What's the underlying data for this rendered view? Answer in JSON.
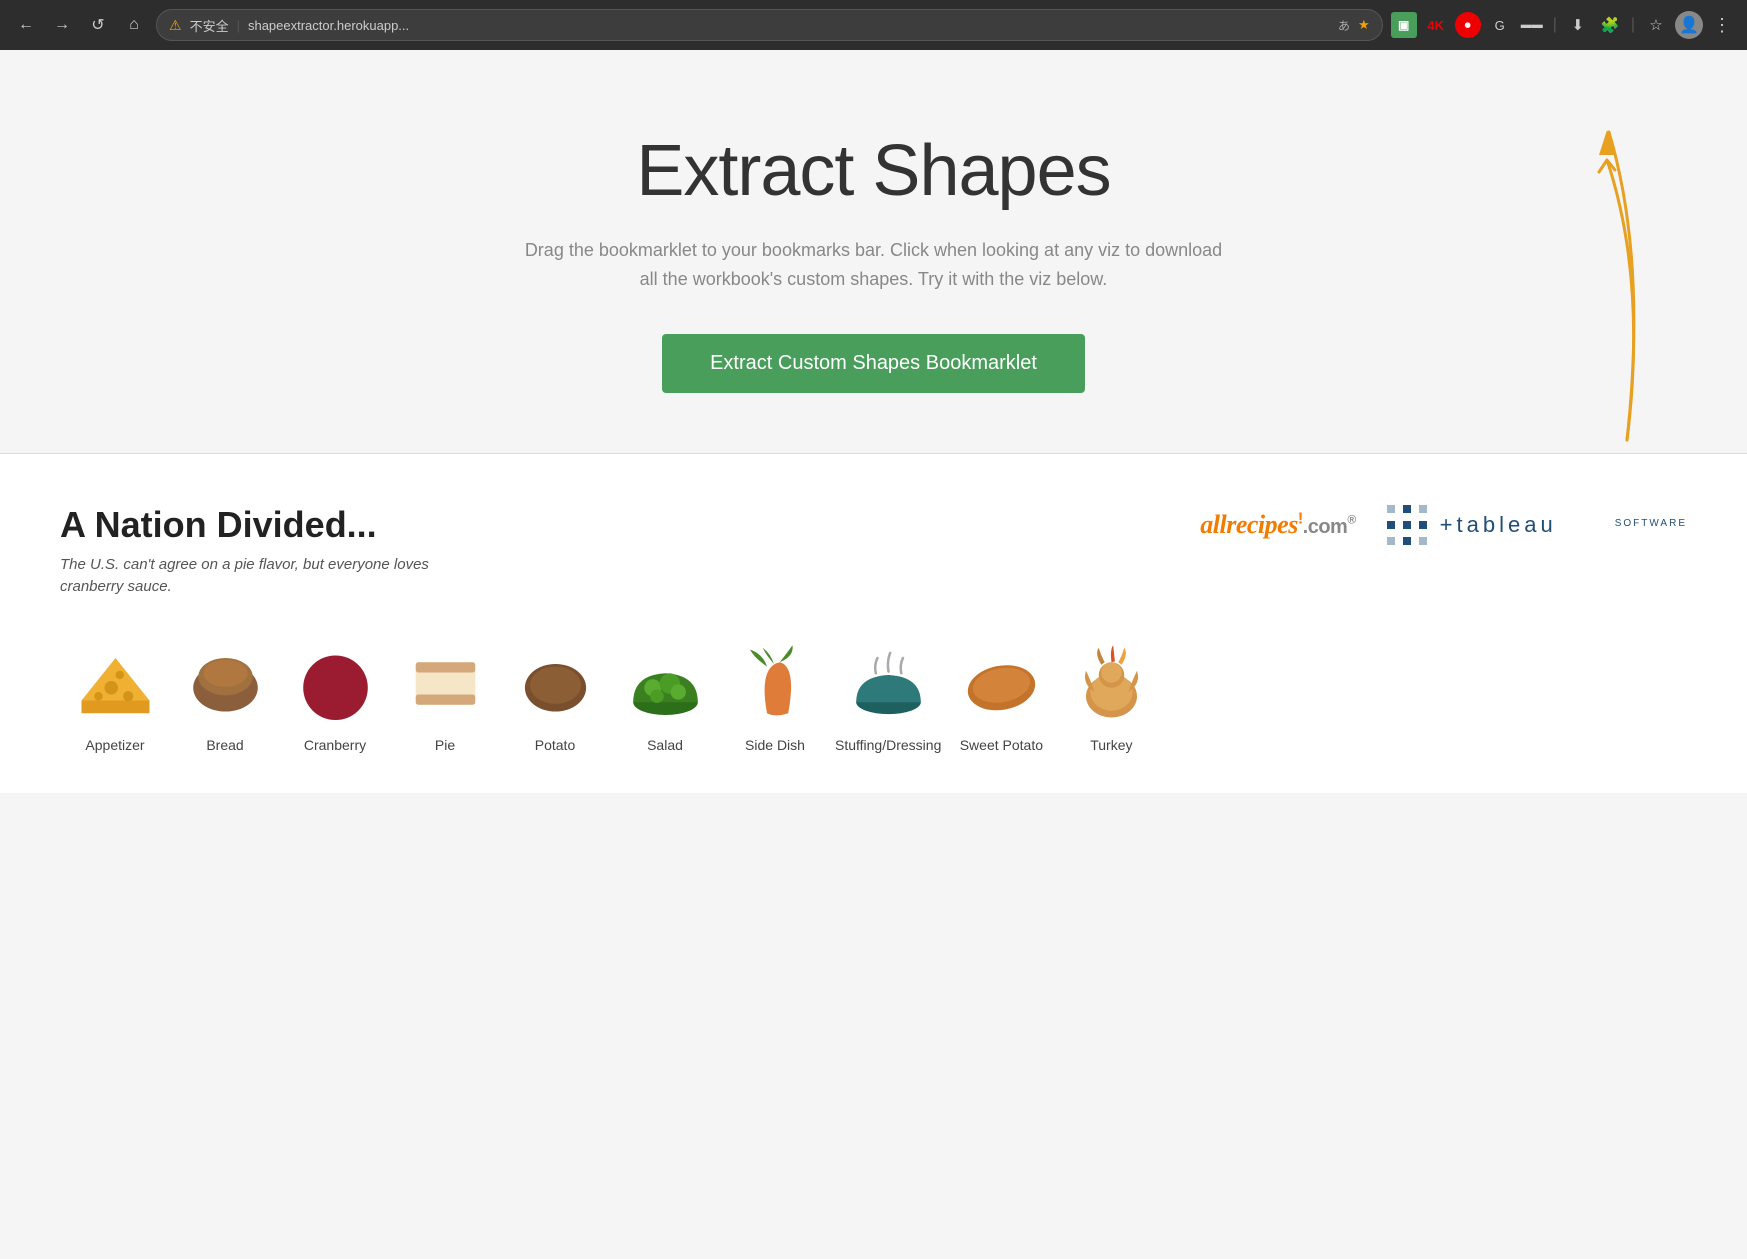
{
  "browser": {
    "url": "shapeextractor.herokuapp...",
    "warning_text": "不安全",
    "nav_back": "←",
    "nav_forward": "→",
    "nav_reload": "↺",
    "nav_home": "⌂"
  },
  "hero": {
    "title": "Extract Shapes",
    "subtitle": "Drag the bookmarklet to your bookmarks bar. Click when looking at any viz to download all the workbook's custom shapes. Try it with the viz below.",
    "button_label": "Extract Custom Shapes Bookmarklet"
  },
  "viz_section": {
    "title": "A Nation Divided...",
    "subtitle": "The U.S. can't agree on a pie flavor, but everyone loves cranberry sauce.",
    "allrecipes_text": "allrecipes",
    "allrecipes_domain": ".com",
    "tableau_text": "+tableau"
  },
  "food_items": [
    {
      "label": "Appetizer",
      "color": "#f0b132",
      "type": "cheese"
    },
    {
      "label": "Bread",
      "color": "#8b5e3c",
      "type": "bread"
    },
    {
      "label": "Cranberry",
      "color": "#9b1c31",
      "type": "cranberry"
    },
    {
      "label": "Pie",
      "color": "#d4a87a",
      "type": "pie"
    },
    {
      "label": "Potato",
      "color": "#7a4f2e",
      "type": "potato"
    },
    {
      "label": "Salad",
      "color": "#4a8c2a",
      "type": "salad"
    },
    {
      "label": "Side Dish",
      "color": "#e07c3a",
      "type": "carrot"
    },
    {
      "label": "Stuffing/Dressing",
      "color": "#2e7a7a",
      "type": "stuffing"
    },
    {
      "label": "Sweet Potato",
      "color": "#c4732a",
      "type": "sweetpotato"
    },
    {
      "label": "Turkey",
      "color": "#d4954a",
      "type": "turkey"
    }
  ]
}
